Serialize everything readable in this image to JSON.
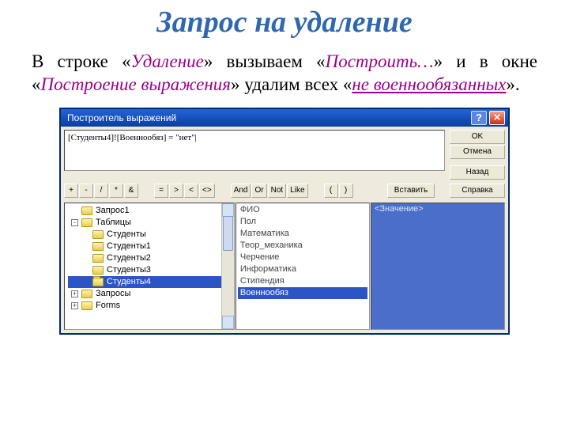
{
  "title": "Запрос на удаление",
  "desc": {
    "part1": "В строке «",
    "q1": "Удаление",
    "part2": "» вызываем «",
    "q2": "Построить…",
    "part3": "» и в окне «",
    "q3": "Построение выражения",
    "part4": "» удалим всех «",
    "q4": "не военнообязанных",
    "part5": "»."
  },
  "builder": {
    "title": "Построитель выражений",
    "expression": "[Студенты4]![Военнообяз] = \"нет\"|",
    "buttons": {
      "ok": "OK",
      "cancel": "Отмена",
      "back": "Назад",
      "help": "Справка",
      "paste": "Вставить"
    },
    "ops": [
      "+",
      "-",
      "/",
      "*",
      "&",
      "=",
      ">",
      "<",
      "<>",
      "And",
      "Or",
      "Not",
      "Like",
      "(",
      ")"
    ],
    "tree": [
      {
        "pm": "",
        "indent": 0,
        "icon": "fld",
        "label": "Запрос1"
      },
      {
        "pm": "-",
        "indent": 0,
        "icon": "fld",
        "label": "Таблицы"
      },
      {
        "pm": "",
        "indent": 1,
        "icon": "fld",
        "label": "Студенты"
      },
      {
        "pm": "",
        "indent": 1,
        "icon": "fld",
        "label": "Студенты1"
      },
      {
        "pm": "",
        "indent": 1,
        "icon": "fld",
        "label": "Студенты2"
      },
      {
        "pm": "",
        "indent": 1,
        "icon": "fld",
        "label": "Студенты3"
      },
      {
        "pm": "",
        "indent": 1,
        "icon": "fld open",
        "label": "Студенты4",
        "sel": true
      },
      {
        "pm": "+",
        "indent": 0,
        "icon": "fld",
        "label": "Запросы"
      },
      {
        "pm": "+",
        "indent": 0,
        "icon": "fld",
        "label": "Forms"
      }
    ],
    "fields": [
      {
        "label": "ФИО"
      },
      {
        "label": "Пол"
      },
      {
        "label": "Математика"
      },
      {
        "label": "Теор_механика"
      },
      {
        "label": "Черчение"
      },
      {
        "label": "Информатика"
      },
      {
        "label": "Стипендия"
      },
      {
        "label": "Военнообяз",
        "sel": true
      }
    ],
    "valuePane": "<Значение>"
  }
}
